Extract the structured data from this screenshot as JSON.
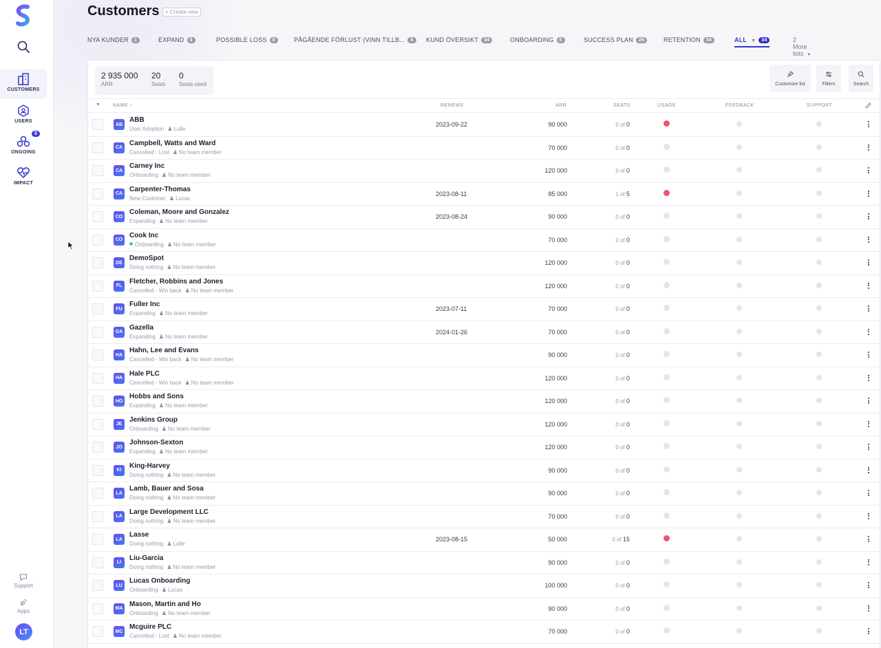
{
  "sidebar": {
    "nav": [
      {
        "label": "CUSTOMERS"
      },
      {
        "label": "USERS"
      },
      {
        "label": "ONGOING",
        "badge": "5"
      },
      {
        "label": "IMPACT"
      }
    ],
    "support_label": "Support",
    "apps_label": "Apps",
    "avatar_initials": "LT"
  },
  "header": {
    "title": "Customers",
    "create_new": "+ Create new"
  },
  "tabs": [
    {
      "label": "NYA KUNDER",
      "count": "1"
    },
    {
      "label": "EXPAND",
      "count": "3"
    },
    {
      "label": "POSSIBLE LOSS",
      "count": "0"
    },
    {
      "label": "PÅGÅENDE FÖRLUST (VINN TILLB...",
      "count": "5"
    },
    {
      "label": "KUND ÖVERSIKT",
      "count": "34"
    },
    {
      "label": "ONBOARDING",
      "count": "5"
    },
    {
      "label": "SUCCESS PLAN",
      "count": "26"
    },
    {
      "label": "RETENTION",
      "count": "34"
    },
    {
      "label": "ALL",
      "count": "34"
    }
  ],
  "more_lists": "2 More lists",
  "stats": {
    "arr_value": "2 935 000",
    "arr_label": "ARR",
    "seats_value": "20",
    "seats_label": "Seats",
    "used_value": "0",
    "used_label": "Seats used"
  },
  "tools": {
    "customize": "Customize list",
    "filters": "Filters",
    "search": "Search"
  },
  "columns": {
    "name": "NAME ↑",
    "renews": "RENEWS",
    "arr": "ARR",
    "seats": "SEATS",
    "usage": "USAGE",
    "feedback": "FEEDBACK",
    "support": "SUPPORT"
  },
  "rows": [
    {
      "initials": "AB",
      "name": "ABB",
      "status": "User Adoption",
      "member": "Lulle",
      "renews": "2023-09-22",
      "arr": "90 000",
      "seats_used": "0",
      "seats_total": "0",
      "usage": "red"
    },
    {
      "initials": "CA",
      "name": "Campbell, Watts and Ward",
      "status": "Cancelled - Lost",
      "member": "No team member",
      "renews": "",
      "arr": "70 000",
      "seats_used": "0",
      "seats_total": "0",
      "usage": "none"
    },
    {
      "initials": "CA",
      "name": "Carney Inc",
      "status": "Onboarding",
      "member": "No team member",
      "renews": "",
      "arr": "120 000",
      "seats_used": "0",
      "seats_total": "0",
      "usage": "none"
    },
    {
      "initials": "CA",
      "name": "Carpenter-Thomas",
      "status": "New Customer",
      "member": "Lucas",
      "renews": "2023-08-11",
      "arr": "85 000",
      "seats_used": "1",
      "seats_total": "5",
      "usage": "red"
    },
    {
      "initials": "CO",
      "name": "Coleman, Moore and Gonzalez",
      "status": "Expanding",
      "member": "No team member",
      "renews": "2023-08-24",
      "arr": "90 000",
      "seats_used": "0",
      "seats_total": "0",
      "usage": "none"
    },
    {
      "initials": "CO",
      "name": "Cook Inc",
      "status": "Onboarding",
      "member": "No team member",
      "renews": "",
      "arr": "70 000",
      "seats_used": "0",
      "seats_total": "0",
      "usage": "none",
      "green_dot": true
    },
    {
      "initials": "DE",
      "name": "DemoSpot",
      "status": "Doing nothing",
      "member": "No team member",
      "renews": "",
      "arr": "120 000",
      "seats_used": "0",
      "seats_total": "0",
      "usage": "none"
    },
    {
      "initials": "FL",
      "name": "Fletcher, Robbins and Jones",
      "status": "Cancelled - Win back",
      "member": "No team member",
      "renews": "",
      "arr": "120 000",
      "seats_used": "0",
      "seats_total": "0",
      "usage": "none"
    },
    {
      "initials": "FU",
      "name": "Fuller Inc",
      "status": "Expanding",
      "member": "No team member",
      "renews": "2023-07-11",
      "arr": "70 000",
      "seats_used": "0",
      "seats_total": "0",
      "usage": "none"
    },
    {
      "initials": "GA",
      "name": "Gazella",
      "status": "Expanding",
      "member": "No team member",
      "renews": "2024-01-26",
      "arr": "70 000",
      "seats_used": "0",
      "seats_total": "0",
      "usage": "none"
    },
    {
      "initials": "HA",
      "name": "Hahn, Lee and Evans",
      "status": "Cancelled - Win back",
      "member": "No team member",
      "renews": "",
      "arr": "90 000",
      "seats_used": "0",
      "seats_total": "0",
      "usage": "none"
    },
    {
      "initials": "HA",
      "name": "Hale PLC",
      "status": "Cancelled - Win back",
      "member": "No team member",
      "renews": "",
      "arr": "120 000",
      "seats_used": "0",
      "seats_total": "0",
      "usage": "none"
    },
    {
      "initials": "HO",
      "name": "Hobbs and Sons",
      "status": "Expanding",
      "member": "No team member",
      "renews": "",
      "arr": "120 000",
      "seats_used": "0",
      "seats_total": "0",
      "usage": "none"
    },
    {
      "initials": "JE",
      "name": "Jenkins Group",
      "status": "Onboarding",
      "member": "No team member",
      "renews": "",
      "arr": "120 000",
      "seats_used": "0",
      "seats_total": "0",
      "usage": "none"
    },
    {
      "initials": "JO",
      "name": "Johnson-Sexton",
      "status": "Expanding",
      "member": "No team member",
      "renews": "",
      "arr": "120 000",
      "seats_used": "0",
      "seats_total": "0",
      "usage": "none"
    },
    {
      "initials": "KI",
      "name": "King-Harvey",
      "status": "Doing nothing",
      "member": "No team member",
      "renews": "",
      "arr": "90 000",
      "seats_used": "0",
      "seats_total": "0",
      "usage": "none"
    },
    {
      "initials": "LA",
      "name": "Lamb, Bauer and Sosa",
      "status": "Doing nothing",
      "member": "No team member",
      "renews": "",
      "arr": "90 000",
      "seats_used": "0",
      "seats_total": "0",
      "usage": "none"
    },
    {
      "initials": "LA",
      "name": "Large Development LLC",
      "status": "Doing nothing",
      "member": "No team member",
      "renews": "",
      "arr": "70 000",
      "seats_used": "0",
      "seats_total": "0",
      "usage": "none"
    },
    {
      "initials": "LA",
      "name": "Lasse",
      "status": "Doing nothing",
      "member": "Lulle",
      "renews": "2023-08-15",
      "arr": "50 000",
      "seats_used": "0",
      "seats_total": "15",
      "usage": "red"
    },
    {
      "initials": "LI",
      "name": "Liu-Garcia",
      "status": "Doing nothing",
      "member": "No team member",
      "renews": "",
      "arr": "90 000",
      "seats_used": "0",
      "seats_total": "0",
      "usage": "none"
    },
    {
      "initials": "LU",
      "name": "Lucas Onboarding",
      "status": "Onboarding",
      "member": "Lucas",
      "renews": "",
      "arr": "100 000",
      "seats_used": "0",
      "seats_total": "0",
      "usage": "none"
    },
    {
      "initials": "MA",
      "name": "Mason, Martin and Ho",
      "status": "Onboarding",
      "member": "No team member",
      "renews": "",
      "arr": "90 000",
      "seats_used": "0",
      "seats_total": "0",
      "usage": "none"
    },
    {
      "initials": "MC",
      "name": "Mcguire PLC",
      "status": "Cancelled - Lost",
      "member": "No team member",
      "renews": "",
      "arr": "70 000",
      "seats_used": "0",
      "seats_total": "0",
      "usage": "none"
    }
  ],
  "seats_of": "of",
  "colors": {
    "accent": "#3434c8",
    "usage_alert": "#f0546a",
    "status_green": "#52c97a"
  }
}
